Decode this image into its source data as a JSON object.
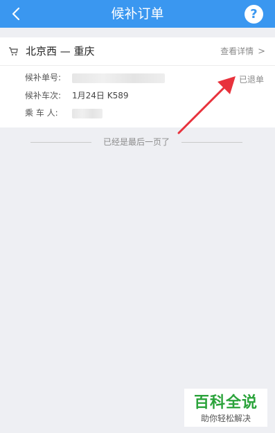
{
  "header": {
    "title": "候补订单",
    "back_icon": "chevron-left-icon",
    "help_label": "?"
  },
  "order": {
    "route": "北京西 — 重庆",
    "detail_link": "查看详情",
    "status": "已退单",
    "fields": [
      {
        "label": "候补单号:",
        "value": ""
      },
      {
        "label": "候补车次:",
        "value": "1月24日 K589"
      },
      {
        "label": "乘 车 人:",
        "value": ""
      }
    ]
  },
  "list_end": "已经是最后一页了",
  "watermark": {
    "title": "百科全说",
    "subtitle": "助你轻松解决"
  },
  "colors": {
    "header": "#3a97f0",
    "annotation_arrow": "#e8323c"
  }
}
